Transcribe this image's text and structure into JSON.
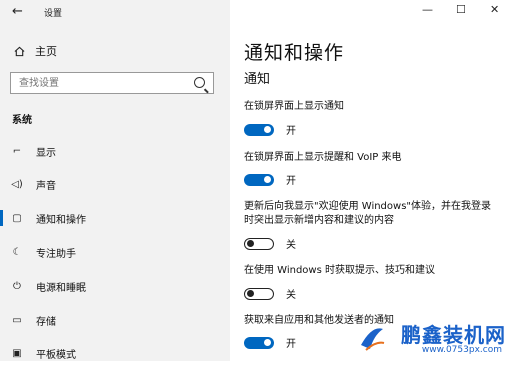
{
  "window": {
    "title": "设置",
    "back_icon": "←",
    "minimize_icon": "—",
    "maximize_icon": "☐",
    "close_icon": "✕"
  },
  "sidebar": {
    "home_label": "主页",
    "search_placeholder": "查找设置",
    "section_label": "系统",
    "items": [
      {
        "label": "显示",
        "icon": "display-icon",
        "glyph": "⌐"
      },
      {
        "label": "声音",
        "icon": "speaker-icon",
        "glyph": "◁)"
      },
      {
        "label": "通知和操作",
        "icon": "notification-icon",
        "glyph": "▢",
        "active": true
      },
      {
        "label": "专注助手",
        "icon": "moon-icon",
        "glyph": "☾"
      },
      {
        "label": "电源和睡眠",
        "icon": "power-icon",
        "glyph": "⏻"
      },
      {
        "label": "存储",
        "icon": "storage-icon",
        "glyph": "▭"
      },
      {
        "label": "平板模式",
        "icon": "tablet-icon",
        "glyph": "▣"
      }
    ]
  },
  "main": {
    "title": "通知和操作",
    "subtitle": "通知",
    "settings": [
      {
        "label": "在锁屏界面上显示通知",
        "state": "开",
        "on": true
      },
      {
        "label": "在锁屏界面上显示提醒和 VoIP 来电",
        "state": "开",
        "on": true
      },
      {
        "label": "更新后向我显示\"欢迎使用 Windows\"体验，并在我登录时突出显示新增内容和建议的内容",
        "state": "关",
        "on": false
      },
      {
        "label": "在使用 Windows 时获取提示、技巧和建议",
        "state": "关",
        "on": false
      },
      {
        "label": "获取来自应用和其他发送者的通知",
        "state": "开",
        "on": true
      }
    ]
  },
  "watermark": {
    "name": "鹏鑫装机网",
    "url": "www.0753px.com",
    "brand_color": "#1b62c9"
  },
  "colors": {
    "accent": "#0067c0",
    "sidebar_bg": "#f2f2f2"
  }
}
